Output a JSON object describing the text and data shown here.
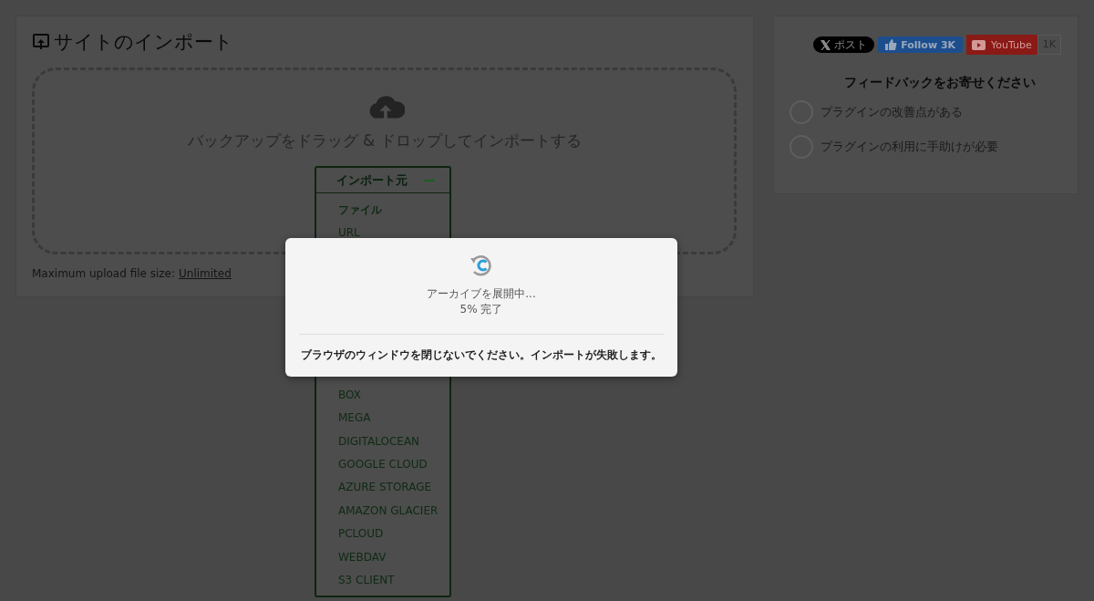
{
  "import_panel": {
    "title": "サイトのインポート",
    "drop_text": "バックアップをドラッグ & ドロップしてインポートする",
    "import_menu": {
      "label": "インポート元",
      "expanded": true,
      "items_before_dialog": [
        {
          "label": "ファイル",
          "selected": true
        },
        {
          "label": "URL",
          "selected": false
        }
      ],
      "items_after_dialog": [
        {
          "label": "BOX",
          "selected": false
        },
        {
          "label": "MEGA",
          "selected": false
        },
        {
          "label": "DIGITALOCEAN",
          "selected": false
        },
        {
          "label": "GOOGLE CLOUD",
          "selected": false
        },
        {
          "label": "AZURE STORAGE",
          "selected": false
        },
        {
          "label": "AMAZON GLACIER",
          "selected": false
        },
        {
          "label": "PCLOUD",
          "selected": false
        },
        {
          "label": "WEBDAV",
          "selected": false
        },
        {
          "label": "S3 CLIENT",
          "selected": false
        }
      ]
    },
    "max_upload": {
      "label": "Maximum upload file size:",
      "value": "Unlimited"
    }
  },
  "sidebar": {
    "share_buttons": [
      {
        "kind": "x",
        "label": "ポスト"
      },
      {
        "kind": "facebook",
        "label": "Follow 3K"
      },
      {
        "kind": "youtube",
        "label": "YouTube",
        "count": "1K"
      }
    ],
    "feedback": {
      "title": "フィードバックをお寄せください",
      "options": [
        {
          "label": "プラグインの改善点がある",
          "selected": false
        },
        {
          "label": "プラグインの利用に手助けが必要",
          "selected": false
        }
      ]
    }
  },
  "progress_dialog": {
    "status": "アーカイブを展開中...",
    "progress": "5% 完了",
    "warning": "ブラウザのウィンドウを閉じないでください。インポートが失敗します。"
  }
}
